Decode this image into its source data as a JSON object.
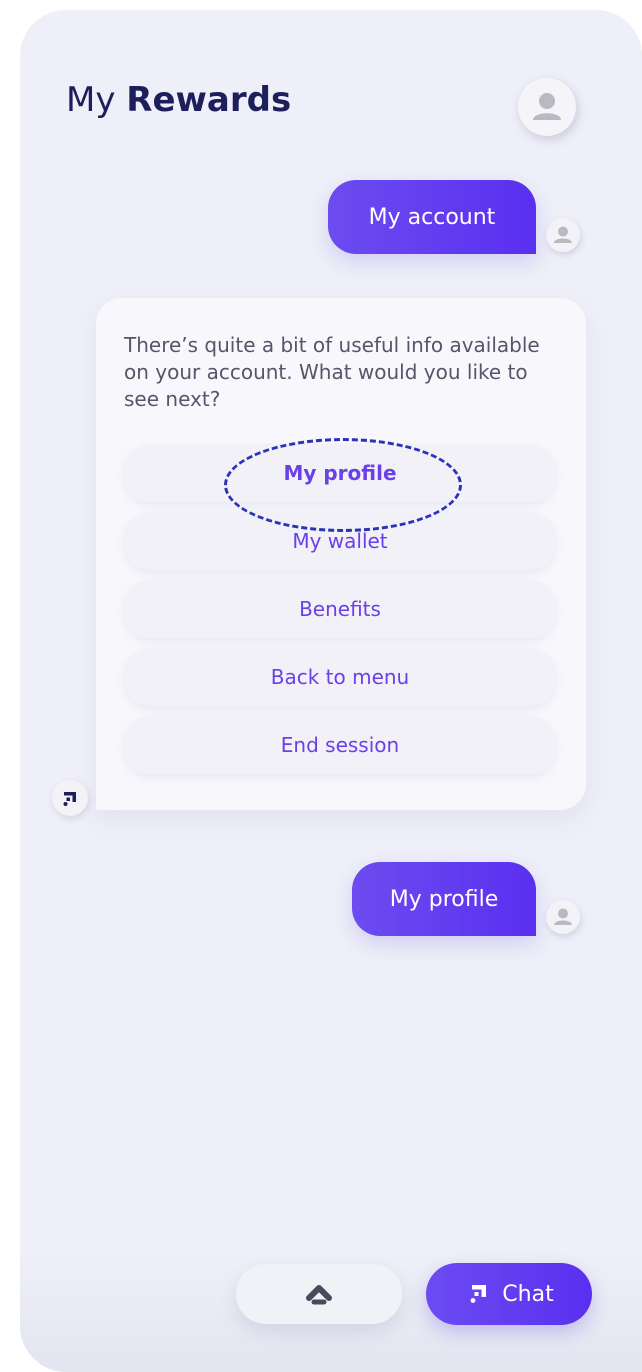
{
  "header": {
    "title_light": "My",
    "title_bold": "Rewards"
  },
  "messages": {
    "user1": "My account",
    "bot_text": "There’s quite a bit of useful info available on your account. What would you like to see next?",
    "options": [
      "My profile",
      "My wallet",
      "Benefits",
      "Back to menu",
      "End session"
    ],
    "user2": "My profile"
  },
  "footer": {
    "chat_label": "Chat"
  },
  "icons": {
    "user_avatar": "person-icon",
    "bot_logo": "bot-logo-icon",
    "scroll_up": "chevron-up-icon",
    "chat": "chat-logo-icon"
  },
  "colors": {
    "accent": "#5a2ff0",
    "title": "#1d1f5c",
    "background": "#eeeff8",
    "highlight": "#2a33b8"
  },
  "highlight": {
    "selected_option": "My profile"
  }
}
